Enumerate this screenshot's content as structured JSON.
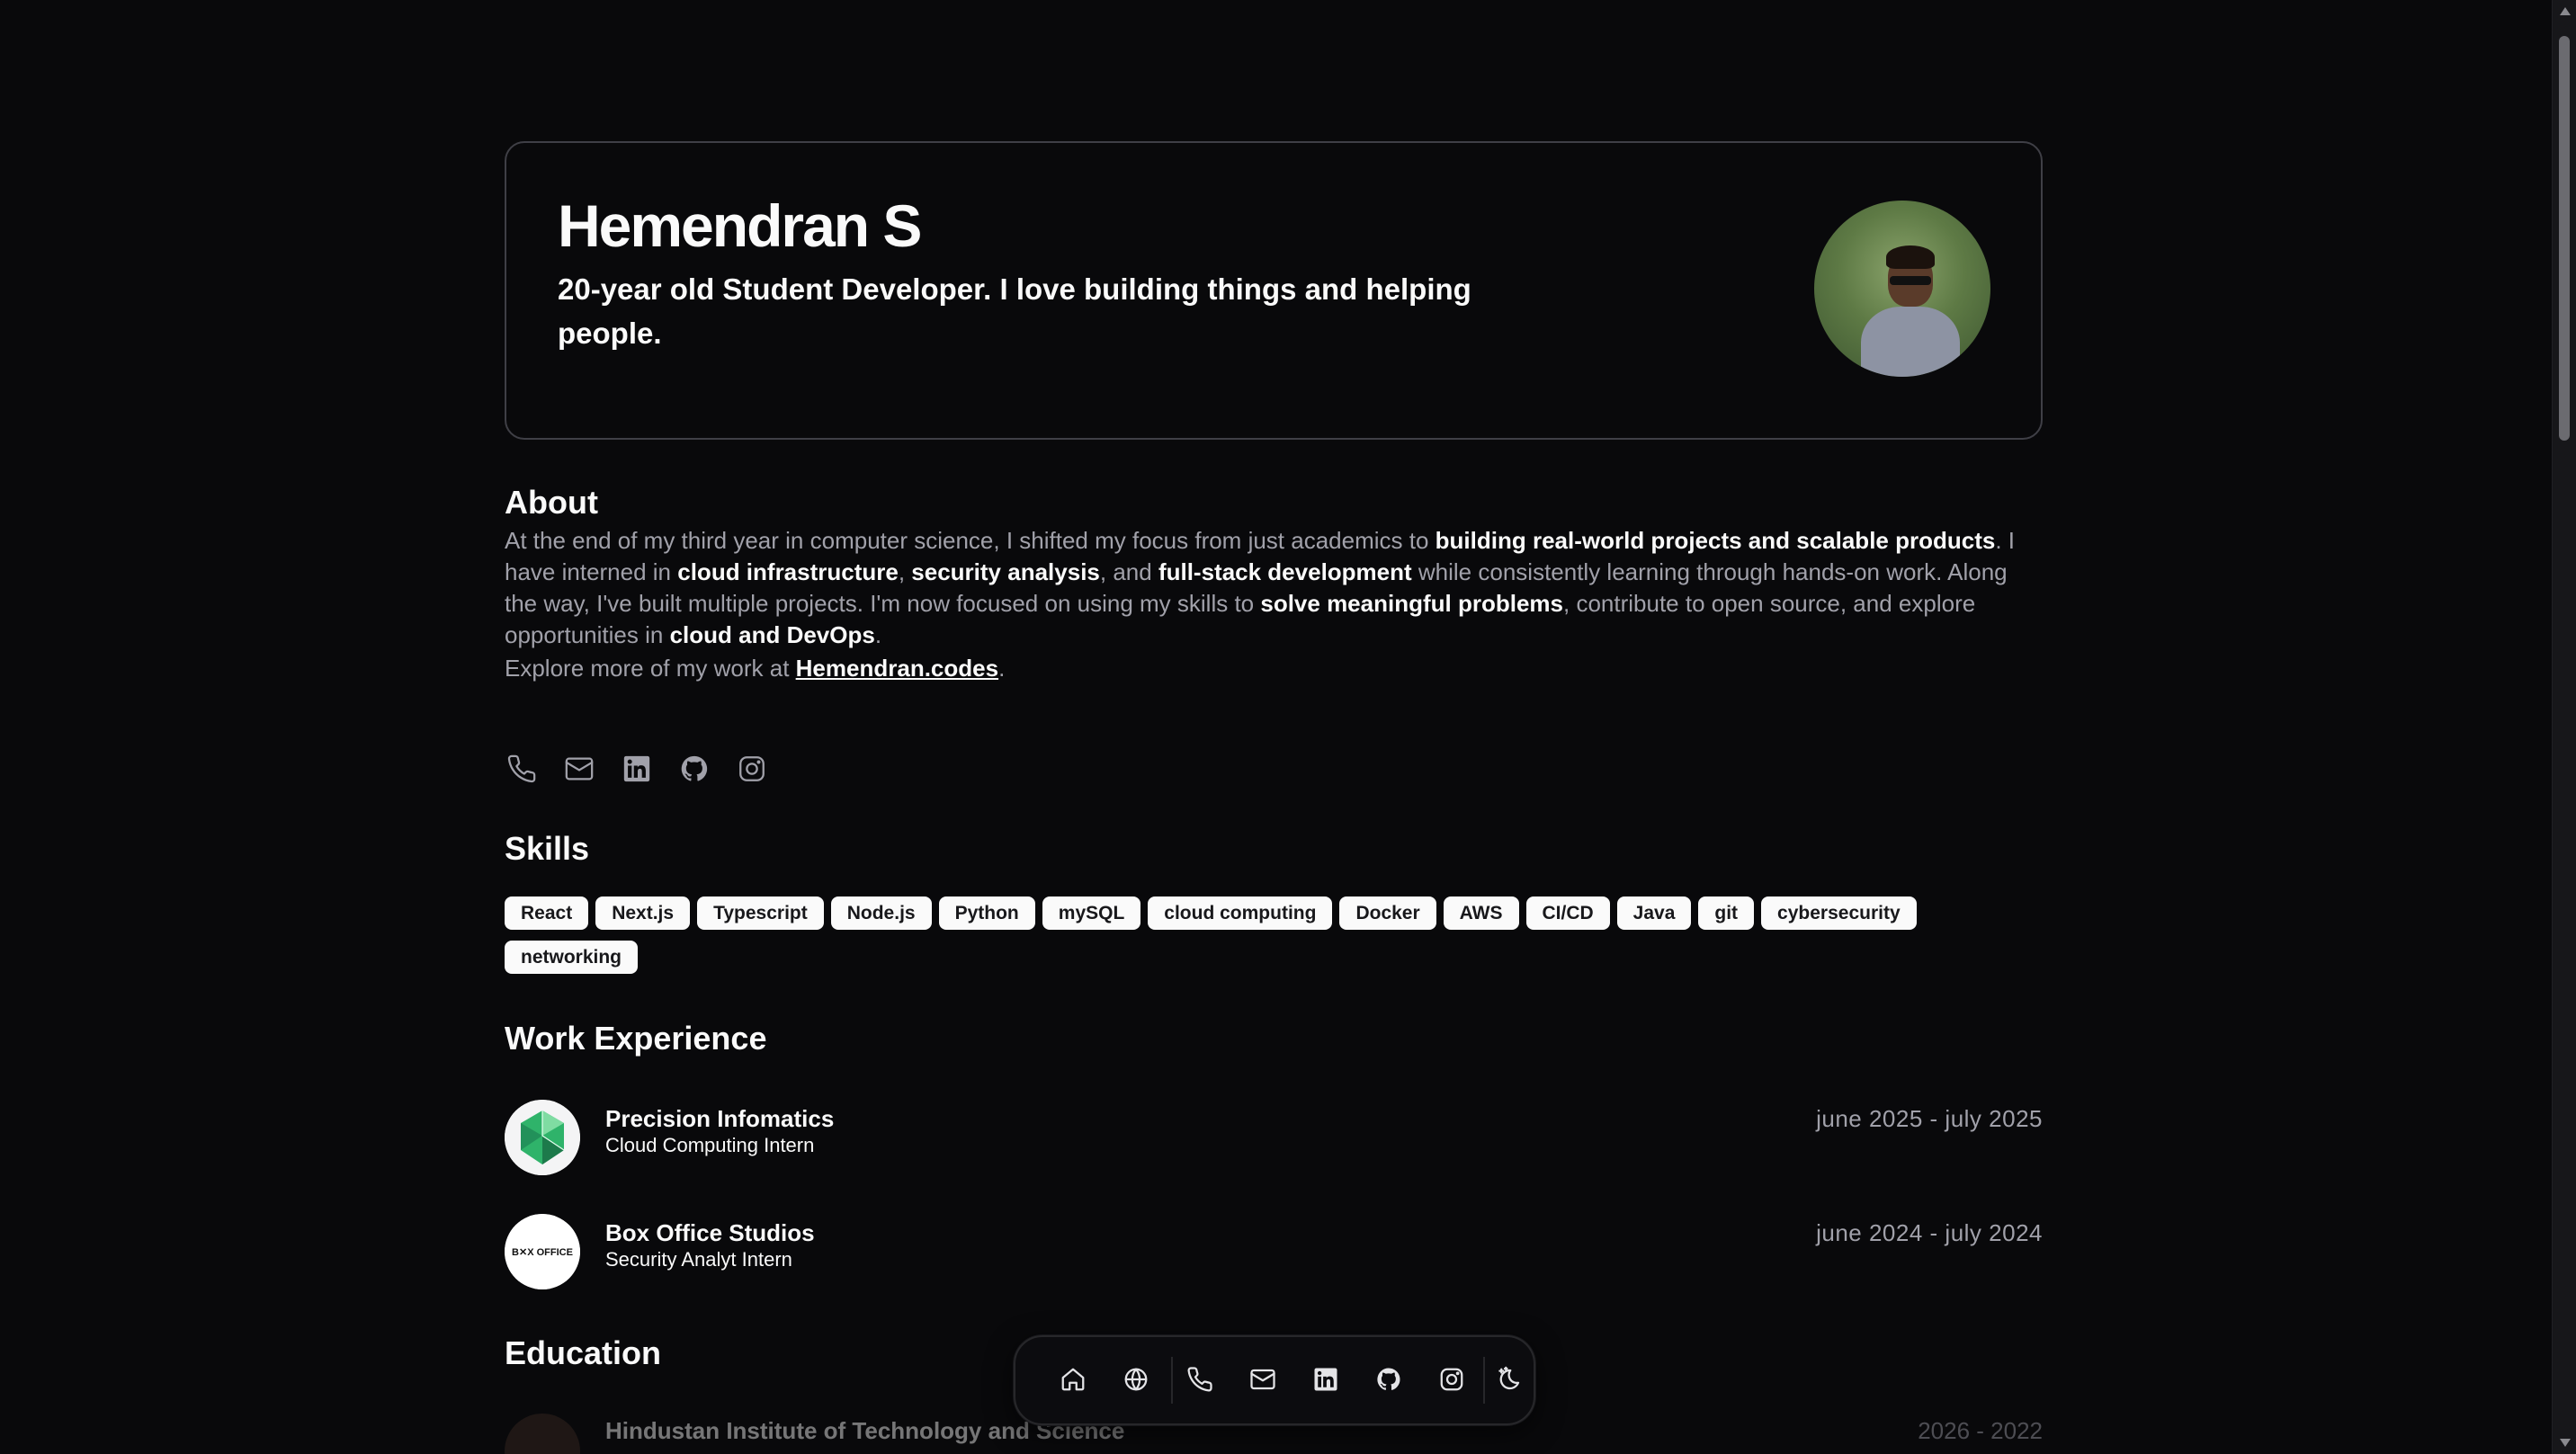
{
  "hero": {
    "name": "Hemendran S",
    "tagline": "20-year old Student Developer. I love building things and helping people."
  },
  "about": {
    "heading": "About",
    "p1": "At the end of my third year in computer science, I shifted my focus from just academics to ",
    "b1": "building real-world projects and scalable products",
    "p2": ". I have interned in ",
    "b2": "cloud infrastructure",
    "p3": ", ",
    "b3": "security analysis",
    "p4": ", and ",
    "b4": "full-stack development",
    "p5": " while consistently learning through hands-on work. Along the way, I've built multiple projects. I'm now focused on using my skills to ",
    "b5": "solve meaningful problems",
    "p6": ", contribute to open source, and explore opportunities in ",
    "b6": "cloud and DevOps",
    "p7": ".",
    "more_prefix": "Explore more of my work at ",
    "more_link": "Hemendran.codes",
    "more_suffix": "."
  },
  "socials": [
    "phone-icon",
    "mail-icon",
    "linkedin-icon",
    "github-icon",
    "instagram-icon"
  ],
  "skills": {
    "heading": "Skills",
    "items": [
      "React",
      "Next.js",
      "Typescript",
      "Node.js",
      "Python",
      "mySQL",
      "cloud computing",
      "Docker",
      "AWS",
      "CI/CD",
      "Java",
      "git",
      "cybersecurity",
      "networking"
    ]
  },
  "work": {
    "heading": "Work Experience",
    "jobs": [
      {
        "company": "Precision Infomatics",
        "role": "Cloud Computing Intern",
        "dates": "june 2025 - july 2025"
      },
      {
        "company": "Box Office Studios",
        "role": "Security Analyt Intern",
        "dates": "june 2024 - july 2024"
      }
    ],
    "logo_text": "B✕X OFFICE"
  },
  "education": {
    "heading": "Education",
    "items": [
      {
        "school": "Hindustan Institute of Technology and Science",
        "dates": "2026 - 2022"
      }
    ]
  },
  "dock": [
    "home-icon",
    "globe-icon",
    "phone-icon",
    "mail-icon",
    "linkedin-icon",
    "github-icon",
    "instagram-icon",
    "theme-toggle-icon"
  ],
  "colors": {
    "background": "#09090b",
    "text": "#fafafa",
    "muted": "#a1a1aa",
    "border": "#3f3f46"
  }
}
